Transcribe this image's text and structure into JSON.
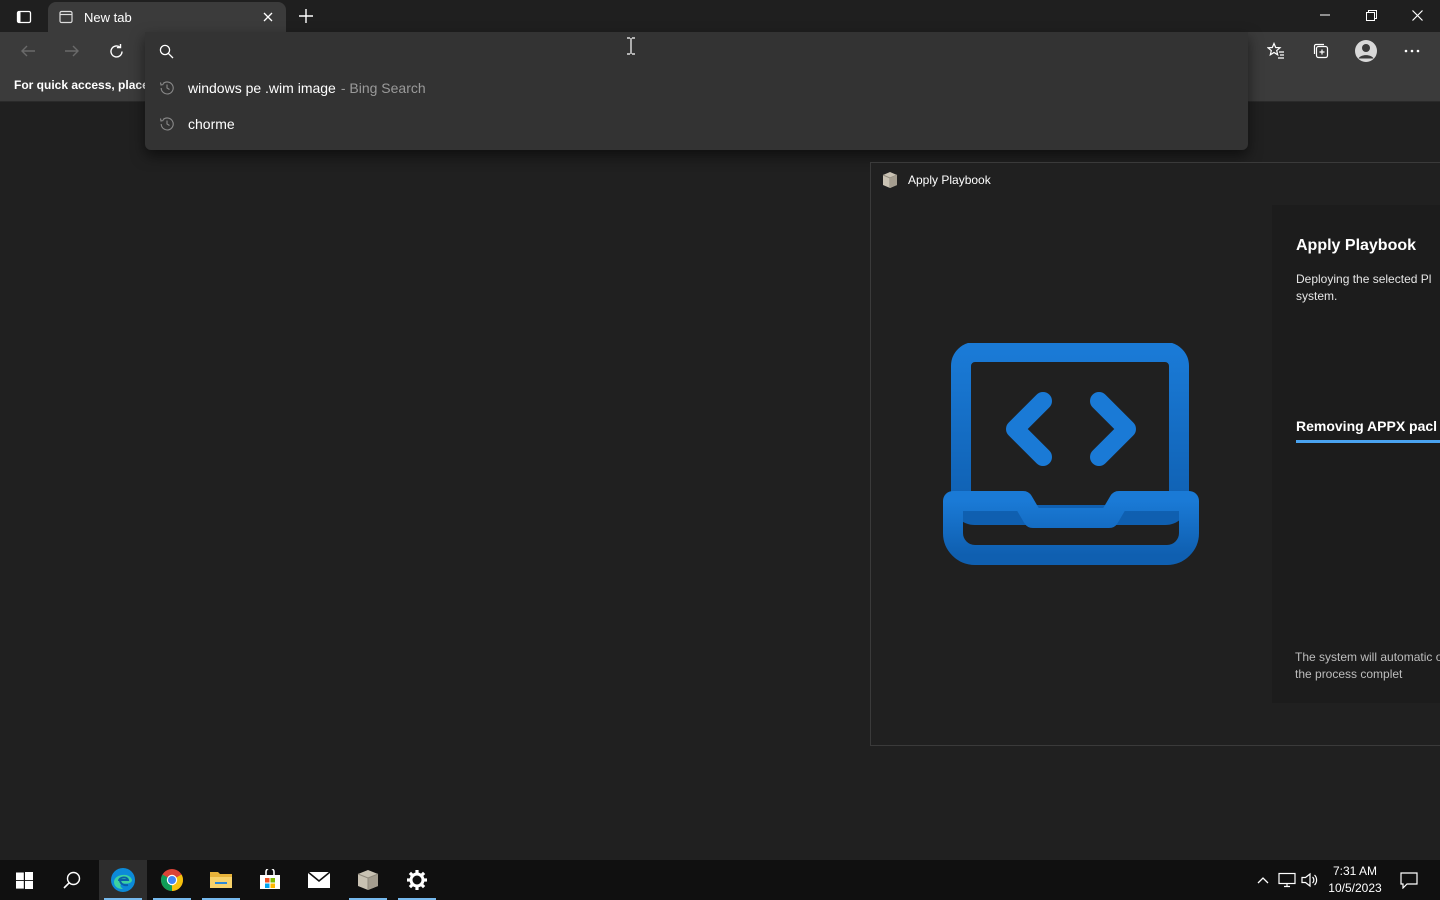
{
  "browser": {
    "tab_title": "New tab",
    "favorites_hint": "For quick access, place y"
  },
  "omnibox": {
    "value": "",
    "suggestions": [
      {
        "text": "windows pe .wim image",
        "sub": "- Bing Search",
        "icon": "history-icon"
      },
      {
        "text": "chorme",
        "sub": "",
        "icon": "history-icon"
      }
    ]
  },
  "playbook": {
    "window_title": "Apply Playbook",
    "heading": "Apply Playbook",
    "description": "Deploying the selected Pl system.",
    "step": "Removing APPX pacl",
    "progress": 1.0,
    "note": "The system will automatic once the process complet",
    "accent": "#1a73c8"
  },
  "taskbar": {
    "apps": [
      "start-icon",
      "search-icon",
      "edge-icon",
      "chrome-icon",
      "file-explorer-icon",
      "store-icon",
      "mail-icon",
      "playbook-app-icon",
      "settings-icon"
    ],
    "time": "7:31 AM",
    "date": "10/5/2023"
  }
}
